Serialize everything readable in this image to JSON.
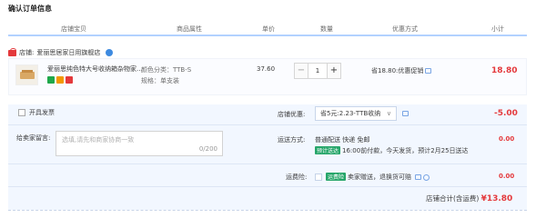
{
  "page": {
    "title": "确认订单信息"
  },
  "columns": [
    "店铺宝贝",
    "商品属性",
    "单价",
    "数量",
    "优惠方式",
    "小计"
  ],
  "shop": {
    "label": "店铺:",
    "name": "爱丽思居家日用旗舰店"
  },
  "item": {
    "name": "爱丽思纯色特大号收纳箱杂物家...",
    "attr_color": "颜色分类：TTB-S",
    "attr_spec": "规格：单支装",
    "price": "37.60",
    "quantity": "1",
    "promotion": "省18.80:优惠促销",
    "subtotal": "18.80",
    "badges": [
      "green-badge",
      "orange-badge",
      "red-badge"
    ]
  },
  "options": {
    "invoice_label": "开具发票",
    "shop_discount_label": "店铺优惠:",
    "shop_discount_value": "省5元:2.23-TTB收纳",
    "shop_discount_amount": "-5.00",
    "message_label": "给卖家留言:",
    "message_placeholder": "选填,请先和商家协商一致",
    "message_count": "0/200",
    "delivery_label": "运送方式:",
    "delivery_method": "普通配送 快递 免邮",
    "delivery_tag": "预计送达",
    "delivery_time": "16:00前付款，今天发货，预计2月25日送达",
    "delivery_amount": "0.00",
    "insurance_label": "运费险:",
    "insurance_tag": "运费险",
    "insurance_text": "卖家赠送，退换货可赔",
    "insurance_amount": "0.00",
    "total_label": "店铺合计(含运费)",
    "total_value": "¥13.80"
  },
  "colors": {
    "accent": "#e4393c",
    "header_line": "#b2d1ff",
    "panel_bg": "#f2f7ff",
    "tag_green": "#27a66a"
  }
}
